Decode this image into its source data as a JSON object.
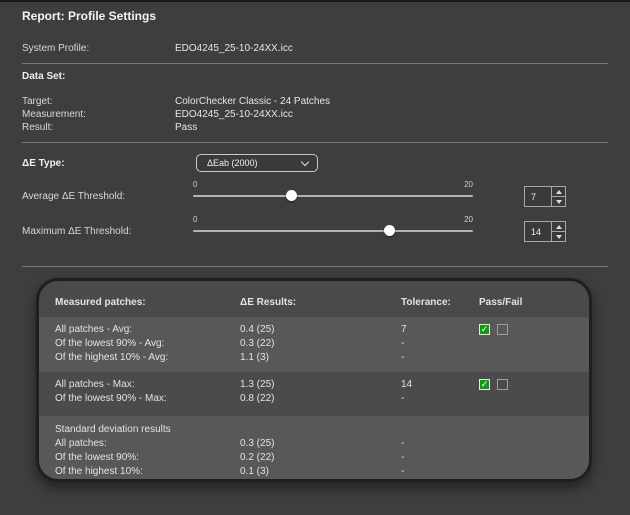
{
  "window": {
    "title": "Report: Profile Settings"
  },
  "system_profile": {
    "label": "System Profile:",
    "value": "EDO4245_25-10-24XX.icc"
  },
  "data_set": {
    "heading": "Data Set:",
    "target": {
      "label": "Target:",
      "value": "ColorChecker Classic - 24 Patches"
    },
    "measurement": {
      "label": "Measurement:",
      "value": "EDO4245_25-10-24XX.icc"
    },
    "result": {
      "label": "Result:",
      "value": "Pass"
    }
  },
  "delta_e_type": {
    "label": "ΔE Type:",
    "selected_option": "ΔEab (2000)"
  },
  "sliders": [
    {
      "label": "Average ΔE Threshold:",
      "min": "0",
      "max": "20",
      "value": "7",
      "percent": 35
    },
    {
      "label": "Maximum ΔE Threshold:",
      "min": "0",
      "max": "20",
      "value": "14",
      "percent": 70
    }
  ],
  "results_panel": {
    "headers": {
      "measured_patches": "Measured patches:",
      "de_results": "ΔE Results:",
      "tolerance": "Tolerance:",
      "pass_fail": "Pass/Fail"
    },
    "sections": [
      {
        "pass_checked": true,
        "fail_checked": false,
        "rows": [
          {
            "label": "All patches - Avg:",
            "result": "0.4 (25)",
            "tolerance": "7"
          },
          {
            "label": "Of the lowest 90% - Avg:",
            "result": "0.3 (22)",
            "tolerance": "-"
          },
          {
            "label": "Of the highest 10% - Avg:",
            "result": "1.1 (3)",
            "tolerance": "-"
          }
        ]
      },
      {
        "pass_checked": true,
        "fail_checked": false,
        "rows": [
          {
            "label": "All patches - Max:",
            "result": "1.3 (25)",
            "tolerance": "14"
          },
          {
            "label": "Of the lowest 90% - Max:",
            "result": "0.8 (22)",
            "tolerance": "-"
          }
        ]
      },
      {
        "rows": [
          {
            "label": "Standard deviation results",
            "result": "",
            "tolerance": ""
          },
          {
            "label": "All patches:",
            "result": "0.3 (25)",
            "tolerance": "-"
          },
          {
            "label": "Of the lowest 90%:",
            "result": "0.2 (22)",
            "tolerance": "-"
          },
          {
            "label": "Of the highest 10%:",
            "result": "0.1 (3)",
            "tolerance": "-"
          }
        ]
      }
    ]
  },
  "colors": {
    "background": "#3e3e3e",
    "pass_green": "#129b12",
    "panel_border": "#1f1f1f",
    "row_light": "#585858",
    "row_dark": "#4b4b4b",
    "slider_handle": "#ffffff"
  }
}
